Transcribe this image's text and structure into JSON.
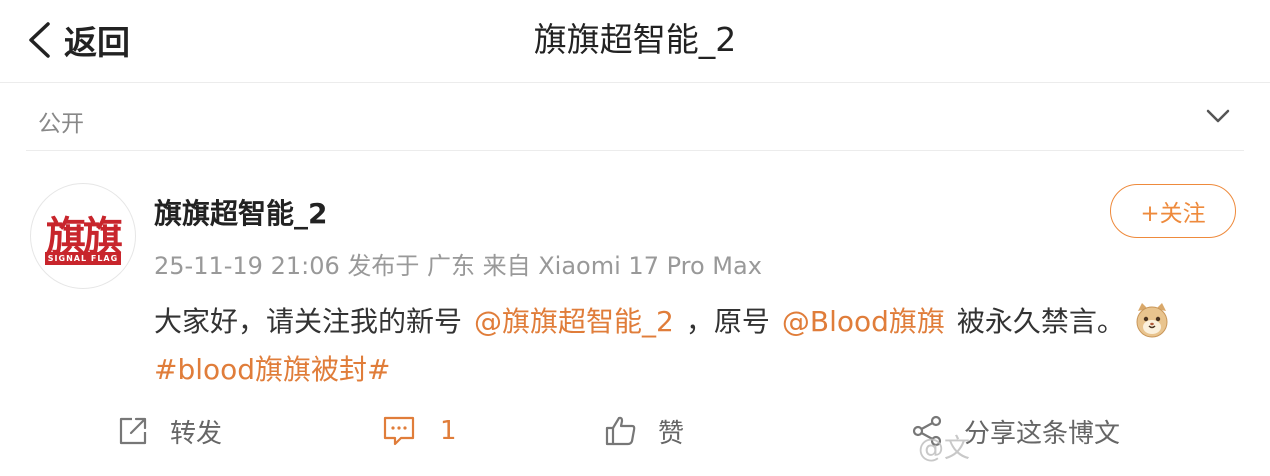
{
  "nav": {
    "back_label": "返回",
    "title": "旗旗超智能_2"
  },
  "visibility": {
    "label": "公开"
  },
  "post": {
    "avatar_text": "旗旗",
    "avatar_subtext": "SIGNAL FLAG",
    "author": "旗旗超智能_2",
    "meta": "25-11-19 21:06  发布于 广东  来自 Xiaomi 17 Pro Max",
    "follow_label": "+关注",
    "text_1": "大家好，请关注我的新号",
    "mention_1": "@旗旗超智能_2",
    "text_2": "，原号",
    "mention_2": "@Blood旗旗",
    "text_3": "被永久禁言。",
    "emoji": "cat-emoji",
    "hashtag": "#blood旗旗被封#"
  },
  "actions": {
    "repost_label": "转发",
    "comment_count": "1",
    "like_label": "赞",
    "share_label": "分享这条博文"
  },
  "watermark": "@文"
}
